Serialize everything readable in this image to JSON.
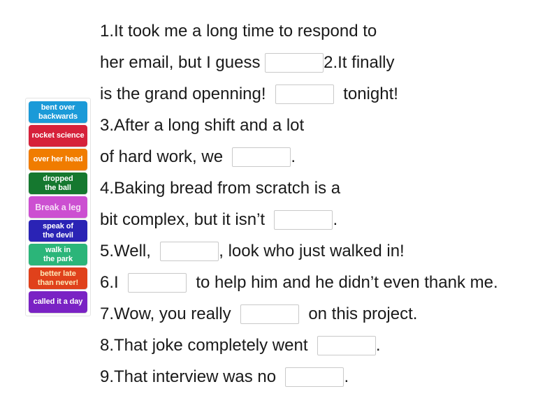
{
  "word_bank": {
    "name": "idiom-word-bank",
    "tiles": [
      {
        "label": "bent over\nbackwards",
        "color": "#1b9ad8",
        "text_color": "#ffffff",
        "large": false
      },
      {
        "label": "rocket science",
        "color": "#d6213a",
        "text_color": "#ffffff",
        "large": false
      },
      {
        "label": "over her head",
        "color": "#f07c00",
        "text_color": "#ffffff",
        "large": false
      },
      {
        "label": "dropped\nthe ball",
        "color": "#15782f",
        "text_color": "#ffffff",
        "large": false
      },
      {
        "label": "Break a leg",
        "color": "#cc4fd1",
        "text_color": "#f6dcf7",
        "large": true
      },
      {
        "label": "speak of\nthe devil",
        "color": "#2a23b5",
        "text_color": "#ffffff",
        "large": false
      },
      {
        "label": "walk in\nthe park",
        "color": "#2bb579",
        "text_color": "#ffffff",
        "large": false
      },
      {
        "label": "better late\nthan never!",
        "color": "#e0411b",
        "text_color": "#fce8b8",
        "large": false
      },
      {
        "label": "called it a day",
        "color": "#7a22c4",
        "text_color": "#ffffff",
        "large": false
      }
    ]
  },
  "exercise": {
    "name": "fill-in-the-blank-sentences",
    "lines": [
      {
        "id": "line-1",
        "parts": [
          {
            "type": "text",
            "value": "1.It took me a long time to respond to"
          }
        ]
      },
      {
        "id": "line-2",
        "parts": [
          {
            "type": "text",
            "value": "her email, but I guess "
          },
          {
            "type": "blank",
            "value": ""
          },
          {
            "type": "text",
            "value": "2.It finally"
          }
        ]
      },
      {
        "id": "line-3",
        "parts": [
          {
            "type": "text",
            "value": "is the grand openning!  "
          },
          {
            "type": "blank",
            "value": ""
          },
          {
            "type": "text",
            "value": "  tonight!"
          }
        ]
      },
      {
        "id": "line-4",
        "parts": [
          {
            "type": "text",
            "value": "3.After a long shift and a lot"
          }
        ]
      },
      {
        "id": "line-5",
        "parts": [
          {
            "type": "text",
            "value": "of hard work, we  "
          },
          {
            "type": "blank",
            "value": ""
          },
          {
            "type": "text",
            "value": "."
          }
        ]
      },
      {
        "id": "line-6",
        "parts": [
          {
            "type": "text",
            "value": "4.Baking bread from scratch is a"
          }
        ]
      },
      {
        "id": "line-7",
        "parts": [
          {
            "type": "text",
            "value": "bit complex, but it isn’t  "
          },
          {
            "type": "blank",
            "value": ""
          },
          {
            "type": "text",
            "value": "."
          }
        ]
      },
      {
        "id": "line-8",
        "parts": [
          {
            "type": "text",
            "value": "5.Well,  "
          },
          {
            "type": "blank",
            "value": ""
          },
          {
            "type": "text",
            "value": ", look who just walked in!"
          }
        ]
      },
      {
        "id": "line-9",
        "parts": [
          {
            "type": "text",
            "value": "6.I  "
          },
          {
            "type": "blank",
            "value": ""
          },
          {
            "type": "text",
            "value": "  to help him and he didn’t even thank me."
          }
        ]
      },
      {
        "id": "line-10",
        "parts": [
          {
            "type": "text",
            "value": "7.Wow, you really  "
          },
          {
            "type": "blank",
            "value": ""
          },
          {
            "type": "text",
            "value": "  on this project."
          }
        ]
      },
      {
        "id": "line-11",
        "parts": [
          {
            "type": "text",
            "value": "8.That joke completely went  "
          },
          {
            "type": "blank",
            "value": ""
          },
          {
            "type": "text",
            "value": "."
          }
        ]
      },
      {
        "id": "line-12",
        "parts": [
          {
            "type": "text",
            "value": "9.That interview was no  "
          },
          {
            "type": "blank",
            "value": ""
          },
          {
            "type": "text",
            "value": "."
          }
        ]
      }
    ]
  }
}
